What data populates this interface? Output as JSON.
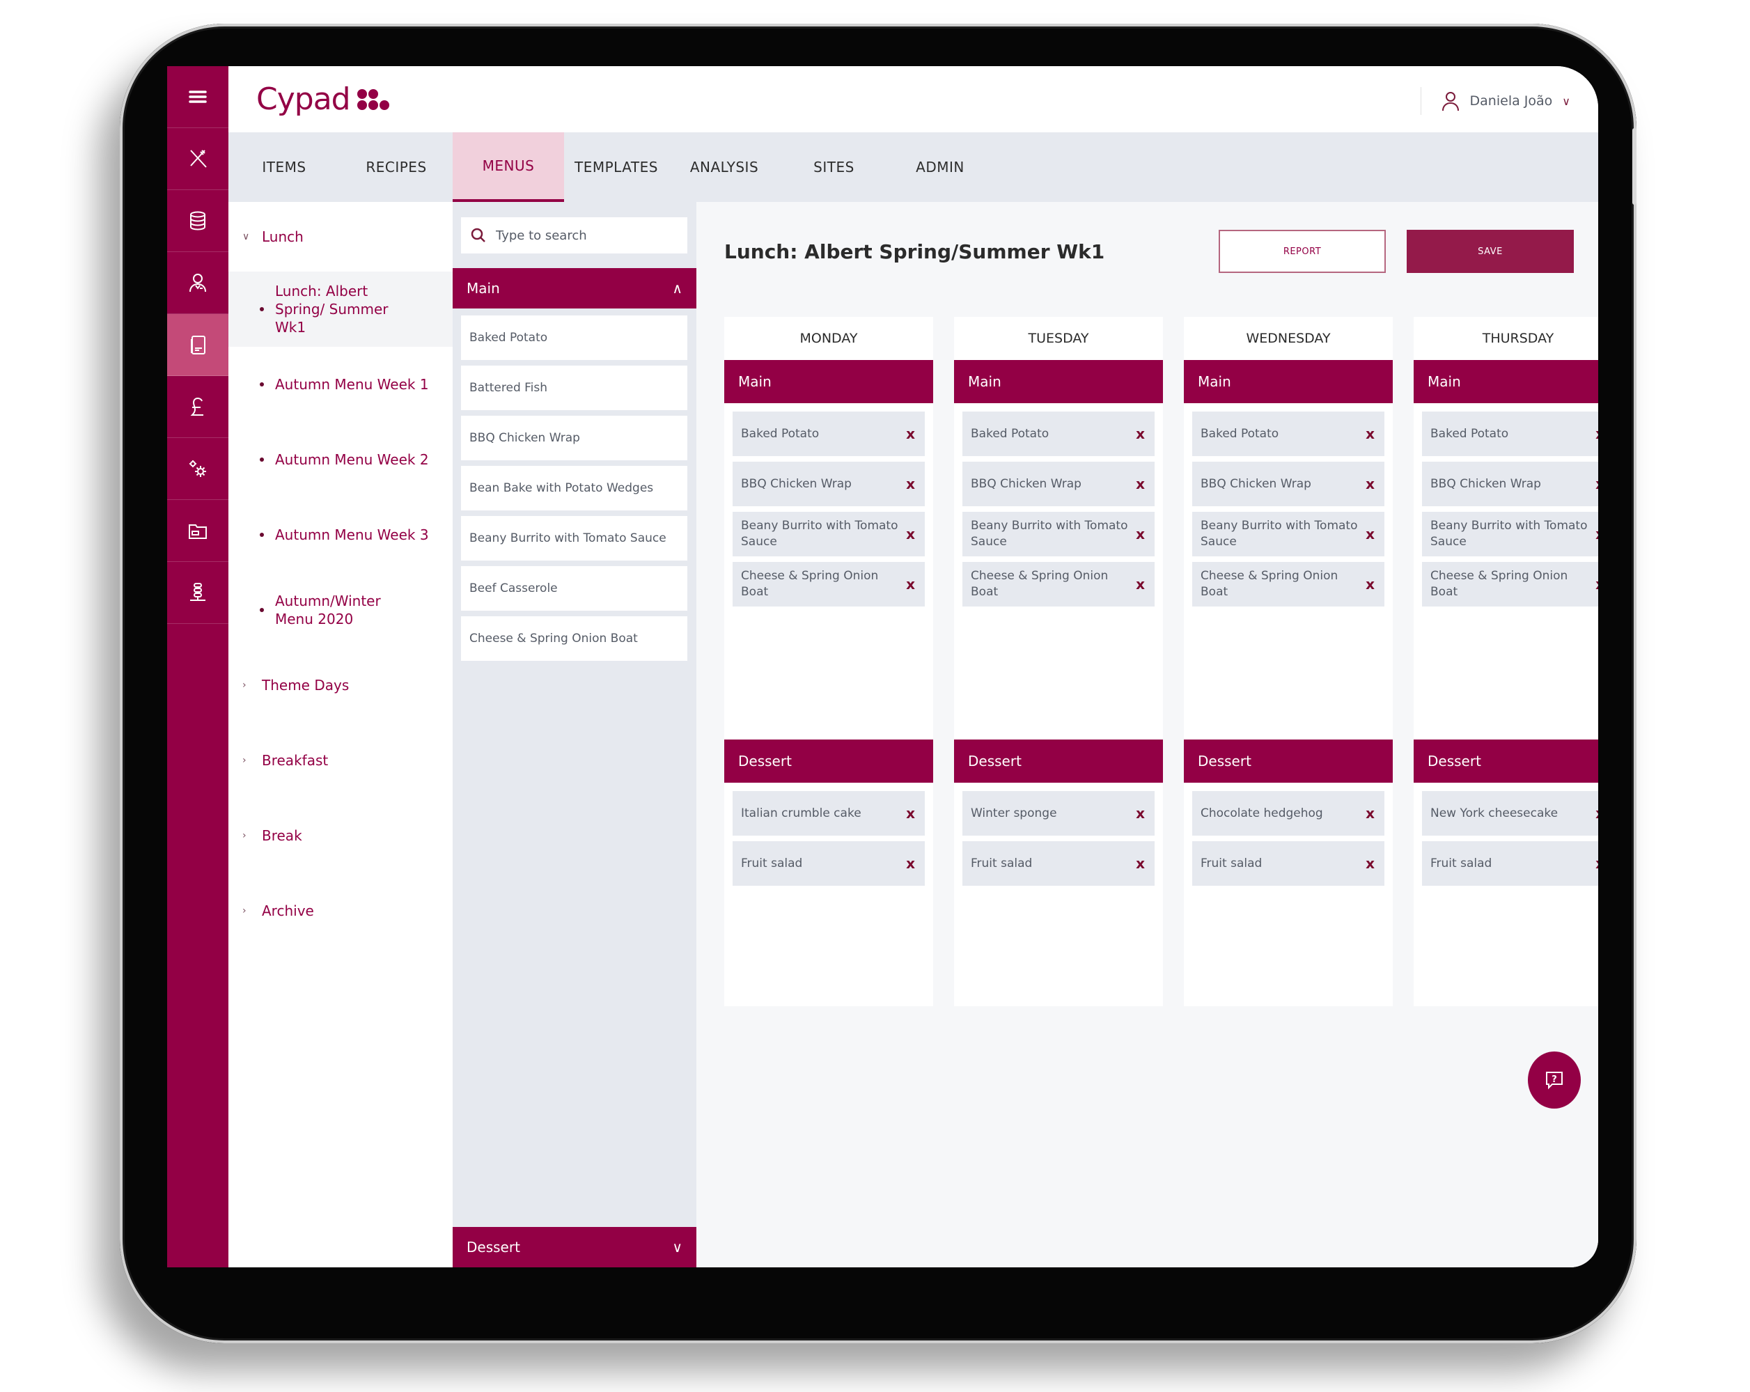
{
  "app": {
    "brand": "Cypad",
    "user_name": "Daniela João"
  },
  "rail": {
    "items": [
      {
        "name": "menu-toggle",
        "icon": "hamburger-icon"
      },
      {
        "name": "items",
        "icon": "cutlery-icon"
      },
      {
        "name": "database",
        "icon": "database-icon"
      },
      {
        "name": "users",
        "icon": "user-icon"
      },
      {
        "name": "menus",
        "icon": "book-icon",
        "active": true
      },
      {
        "name": "costs",
        "icon": "pound-icon"
      },
      {
        "name": "settings",
        "icon": "gears-icon"
      },
      {
        "name": "files",
        "icon": "folder-icon"
      },
      {
        "name": "network",
        "icon": "server-icon"
      }
    ]
  },
  "tabs": [
    {
      "label": "ITEMS",
      "active": false
    },
    {
      "label": "RECIPES",
      "active": false
    },
    {
      "label": "MENUS",
      "active": true
    },
    {
      "label": "TEMPLATES",
      "active": false
    },
    {
      "label": "ANALYSIS",
      "active": false
    },
    {
      "label": "SITES",
      "active": false
    },
    {
      "label": "ADMIN",
      "active": false
    }
  ],
  "tree": {
    "lunch": "Lunch",
    "lunch_items": [
      "Lunch: Albert Spring/ Summer Wk1",
      "Autumn Menu Week 1",
      "Autumn Menu Week 2",
      "Autumn Menu Week 3",
      "Autumn/Winter Menu 2020"
    ],
    "groups": [
      "Theme Days",
      "Breakfast",
      "Break",
      "Archive"
    ]
  },
  "picker": {
    "search_placeholder": "Type to search",
    "main_label": "Main",
    "dessert_label": "Dessert",
    "items": [
      "Baked Potato",
      "Battered Fish",
      "BBQ Chicken Wrap",
      "Bean Bake with Potato Wedges",
      "Beany Burrito with Tomato Sauce",
      "Beef Casserole",
      "Cheese & Spring Onion Boat"
    ]
  },
  "main": {
    "title": "Lunch: Albert Spring/Summer Wk1",
    "report_label": "REPORT",
    "save_label": "SAVE",
    "main_label": "Main",
    "dessert_label": "Dessert",
    "days": [
      {
        "name": "MONDAY",
        "main": [
          "Baked Potato",
          "BBQ Chicken Wrap",
          "Beany Burrito with Tomato Sauce",
          "Cheese & Spring Onion Boat"
        ],
        "dessert": [
          "Italian crumble cake",
          "Fruit salad"
        ]
      },
      {
        "name": "TUESDAY",
        "main": [
          "Baked Potato",
          "BBQ Chicken Wrap",
          "Beany Burrito with Tomato Sauce",
          "Cheese & Spring Onion Boat"
        ],
        "dessert": [
          "Winter sponge",
          "Fruit salad"
        ]
      },
      {
        "name": "WEDNESDAY",
        "main": [
          "Baked Potato",
          "BBQ Chicken Wrap",
          "Beany Burrito with Tomato Sauce",
          "Cheese & Spring Onion Boat"
        ],
        "dessert": [
          "Chocolate hedgehog",
          "Fruit salad"
        ]
      },
      {
        "name": "THURSDAY",
        "main": [
          "Baked Potato",
          "BBQ Chicken Wrap",
          "Beany Burrito with Tomato Sauce",
          "Cheese & Spring Onion Boat"
        ],
        "dessert": [
          "New York cheesecake",
          "Fruit salad"
        ]
      }
    ],
    "remove_glyph": "x"
  },
  "colors": {
    "brand": "#930045",
    "active_tab_bg": "#f1d0dc",
    "panel_bg": "#e6e9ef"
  }
}
